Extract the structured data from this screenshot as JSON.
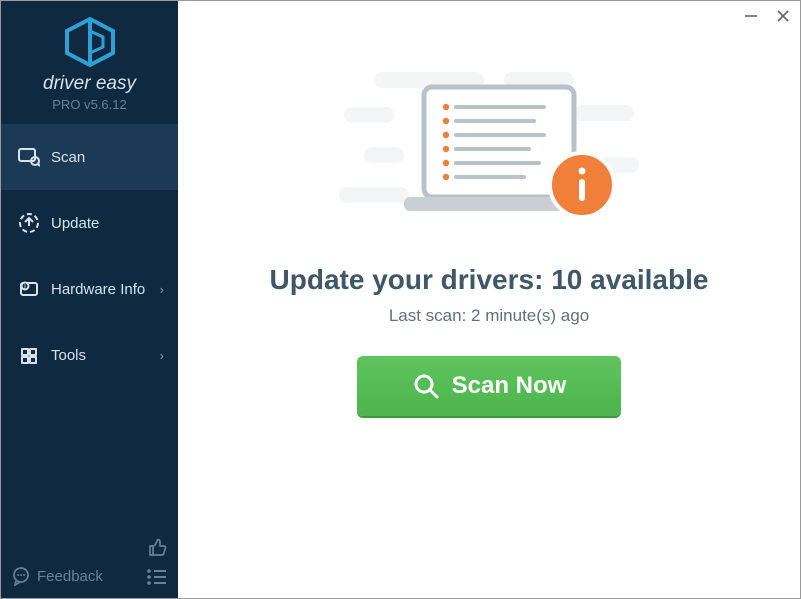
{
  "brand": {
    "wordmark": "driver easy",
    "version_prefix": "PRO v",
    "version": "5.6.12"
  },
  "nav": {
    "scan": "Scan",
    "update": "Update",
    "hardware": "Hardware Info",
    "tools": "Tools"
  },
  "footer": {
    "feedback": "Feedback"
  },
  "main": {
    "headline_prefix": "Update your drivers: ",
    "available_count": "10",
    "headline_suffix": " available",
    "last_scan_prefix": "Last scan: ",
    "last_scan_value": "2 minute(s) ago",
    "scan_button": "Scan Now"
  },
  "colors": {
    "accent": "#2ea0d6",
    "orange": "#f07f3a",
    "green": "#5fc45f"
  }
}
